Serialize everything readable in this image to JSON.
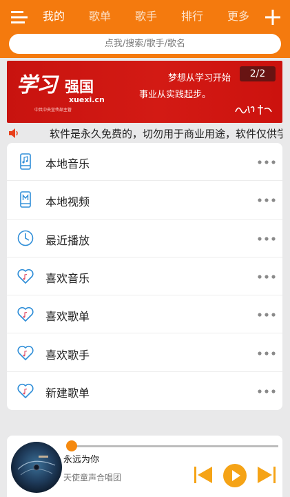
{
  "header": {
    "tabs": [
      {
        "label": "我的",
        "active": true
      },
      {
        "label": "歌单",
        "active": false
      },
      {
        "label": "歌手",
        "active": false
      },
      {
        "label": "排行",
        "active": false
      },
      {
        "label": "更多",
        "active": false
      }
    ],
    "search_placeholder": "点我/搜索/歌手/歌名",
    "accent": "#f47a0e",
    "menu_icon": "menu-icon",
    "add_icon": "plus-icon"
  },
  "banner": {
    "logo_text": "学习",
    "brand": "强国",
    "domain": "xuexi.cn",
    "subtitle": "中共中央宣传部主管",
    "slogan_line1": "梦想从学习开始",
    "slogan_line2": "事业从实践起步。",
    "page_indicator": "2/2"
  },
  "notice": {
    "text": "软件是永久免费的，切勿用于商业用途，软件仅供学习交流使用",
    "icon": "speaker-icon"
  },
  "menu": {
    "items": [
      {
        "label": "本地音乐",
        "icon": "local-music-icon"
      },
      {
        "label": "本地视频",
        "icon": "local-video-icon"
      },
      {
        "label": "最近播放",
        "icon": "clock-icon"
      },
      {
        "label": "喜欢音乐",
        "icon": "heart-music-icon"
      },
      {
        "label": "喜欢歌单",
        "icon": "heart-music-icon"
      },
      {
        "label": "喜欢歌手",
        "icon": "heart-music-icon"
      },
      {
        "label": "新建歌单",
        "icon": "heart-music-icon"
      }
    ]
  },
  "player": {
    "title": "永远为你",
    "artist": "天使童声合唱团",
    "progress": 0.0,
    "controls": [
      "previous-icon",
      "play-icon",
      "next-icon"
    ]
  }
}
